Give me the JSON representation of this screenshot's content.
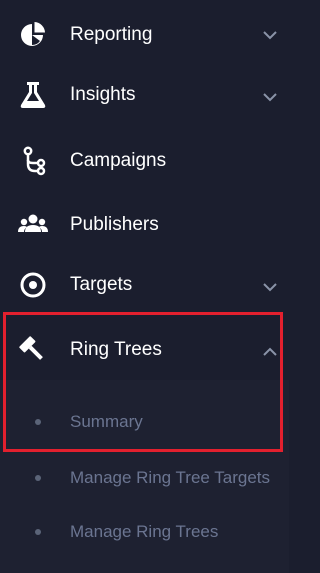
{
  "nav": {
    "items": [
      {
        "label": "Reporting",
        "icon": "pie-chart-icon",
        "expanded": false
      },
      {
        "label": "Insights",
        "icon": "flask-icon",
        "expanded": false
      },
      {
        "label": "Campaigns",
        "icon": "branch-icon"
      },
      {
        "label": "Publishers",
        "icon": "users-icon"
      },
      {
        "label": "Targets",
        "icon": "target-icon",
        "expanded": false
      },
      {
        "label": "Ring Trees",
        "icon": "gavel-icon",
        "expanded": true
      }
    ],
    "ring_trees_submenu": [
      {
        "label": "Summary"
      },
      {
        "label": "Manage Ring Tree Targets"
      },
      {
        "label": "Manage Ring Trees"
      }
    ]
  },
  "colors": {
    "background": "#1b1e2e",
    "submenu_background": "#1e2131",
    "label": "#ffffff",
    "sublabel": "#6b7591",
    "highlight": "#e3202e"
  }
}
